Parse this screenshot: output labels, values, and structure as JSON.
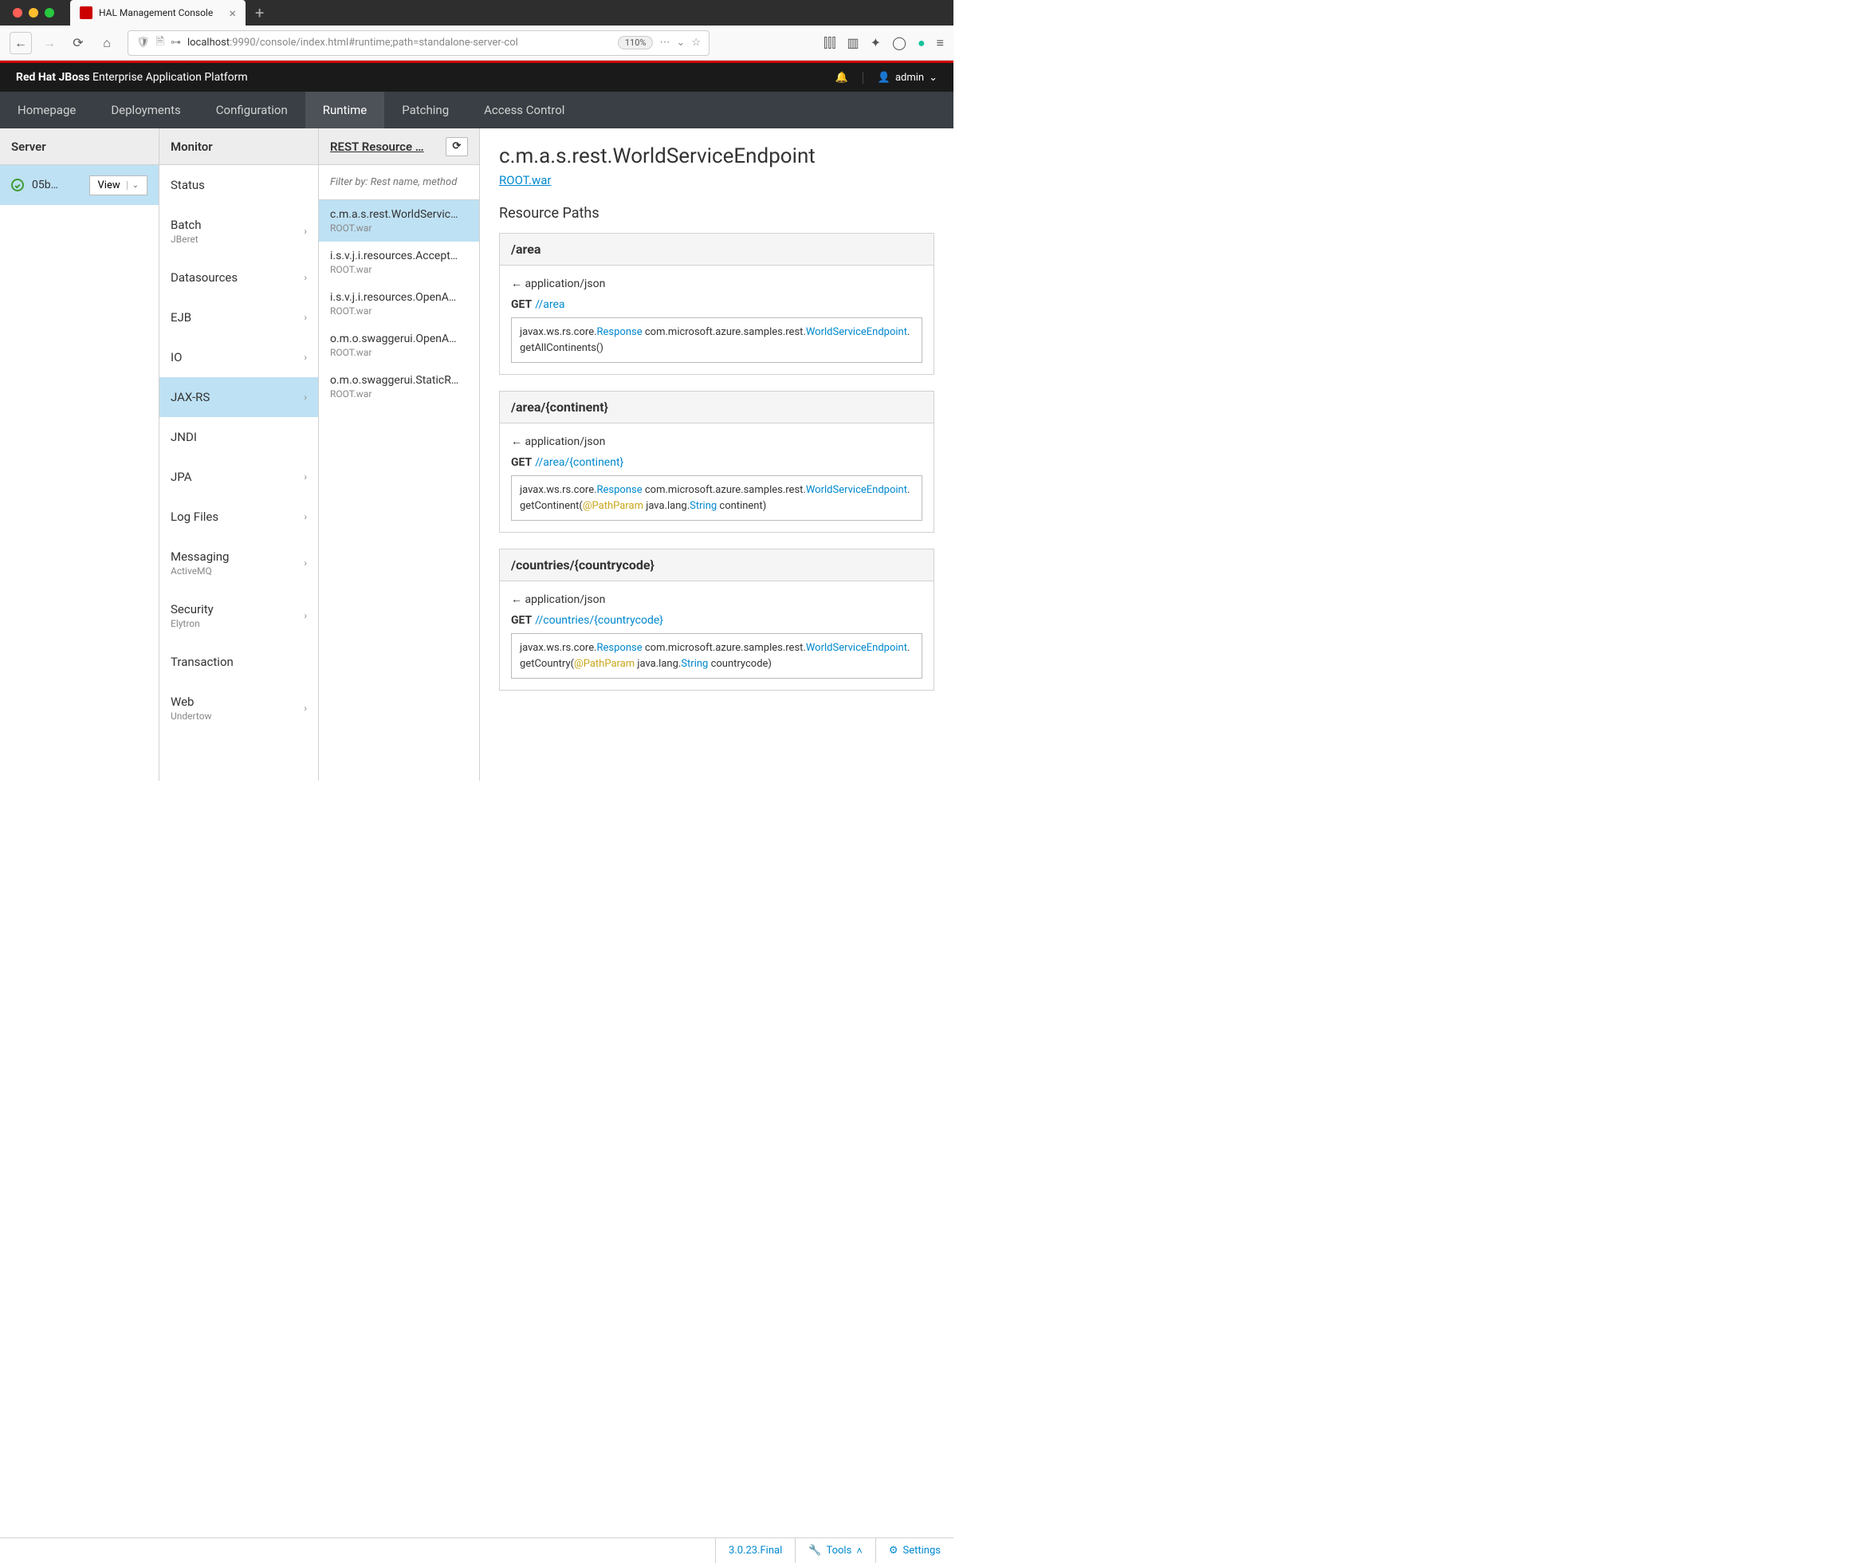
{
  "browser": {
    "tab_title": "HAL Management Console",
    "url_prefix": "localhost",
    "url_rest": ":9990/console/index.html#runtime;path=standalone-server-col",
    "zoom": "110%"
  },
  "header": {
    "brand_bold": "Red Hat JBoss",
    "brand_rest": " Enterprise Application Platform",
    "user": "admin"
  },
  "nav": {
    "items": [
      "Homepage",
      "Deployments",
      "Configuration",
      "Runtime",
      "Patching",
      "Access Control"
    ],
    "active": "Runtime"
  },
  "server_col": {
    "header": "Server",
    "name": "05b…",
    "view": "View"
  },
  "monitor_col": {
    "header": "Monitor",
    "items": [
      {
        "label": "Status",
        "sub": "",
        "chev": false
      },
      {
        "label": "Batch",
        "sub": "JBeret",
        "chev": true
      },
      {
        "label": "Datasources",
        "sub": "",
        "chev": true
      },
      {
        "label": "EJB",
        "sub": "",
        "chev": true
      },
      {
        "label": "IO",
        "sub": "",
        "chev": true
      },
      {
        "label": "JAX-RS",
        "sub": "",
        "chev": true,
        "active": true
      },
      {
        "label": "JNDI",
        "sub": "",
        "chev": false
      },
      {
        "label": "JPA",
        "sub": "",
        "chev": true
      },
      {
        "label": "Log Files",
        "sub": "",
        "chev": true
      },
      {
        "label": "Messaging",
        "sub": "ActiveMQ",
        "chev": true
      },
      {
        "label": "Security",
        "sub": "Elytron",
        "chev": true
      },
      {
        "label": "Transaction",
        "sub": "",
        "chev": false
      },
      {
        "label": "Web",
        "sub": "Undertow",
        "chev": true
      }
    ]
  },
  "rest_col": {
    "header": "REST Resource …",
    "filter_placeholder": "Filter by: Rest name, method",
    "items": [
      {
        "title": "c.m.a.s.rest.WorldServic…",
        "sub": "ROOT.war",
        "active": true
      },
      {
        "title": "i.s.v.j.i.resources.Accept…",
        "sub": "ROOT.war"
      },
      {
        "title": "i.s.v.j.i.resources.OpenA…",
        "sub": "ROOT.war"
      },
      {
        "title": "o.m.o.swaggerui.OpenA…",
        "sub": "ROOT.war"
      },
      {
        "title": "o.m.o.swaggerui.StaticR…",
        "sub": "ROOT.war"
      }
    ]
  },
  "main": {
    "title": "c.m.a.s.rest.WorldServiceEndpoint",
    "link": "ROOT.war",
    "section": "Resource Paths",
    "resources": [
      {
        "path": "/area",
        "mime": "← application/json",
        "method": "GET",
        "url": "//area",
        "code_parts": [
          "javax.ws.rs.core.",
          "Response",
          " com.microsoft.azure.samples.rest.",
          "WorldServiceEndpoint",
          ".getAllContinents()"
        ]
      },
      {
        "path": "/area/{continent}",
        "mime": "← application/json",
        "method": "GET",
        "url": "//area/{continent}",
        "code_parts": [
          "javax.ws.rs.core.",
          "Response",
          " com.microsoft.azure.samples.rest.",
          "WorldServiceEndpoint",
          ".getContinent(",
          "@PathParam",
          " java.lang.",
          "String",
          " continent)"
        ]
      },
      {
        "path": "/countries/{countrycode}",
        "mime": "← application/json",
        "method": "GET",
        "url": "//countries/{countrycode}",
        "code_parts": [
          "javax.ws.rs.core.",
          "Response",
          " com.microsoft.azure.samples.rest.",
          "WorldServiceEndpoint",
          ".getCountry(",
          "@PathParam",
          " java.lang.",
          "String",
          " countrycode)"
        ]
      }
    ]
  },
  "footer": {
    "version": "3.0.23.Final",
    "tools": "Tools",
    "settings": "Settings"
  }
}
